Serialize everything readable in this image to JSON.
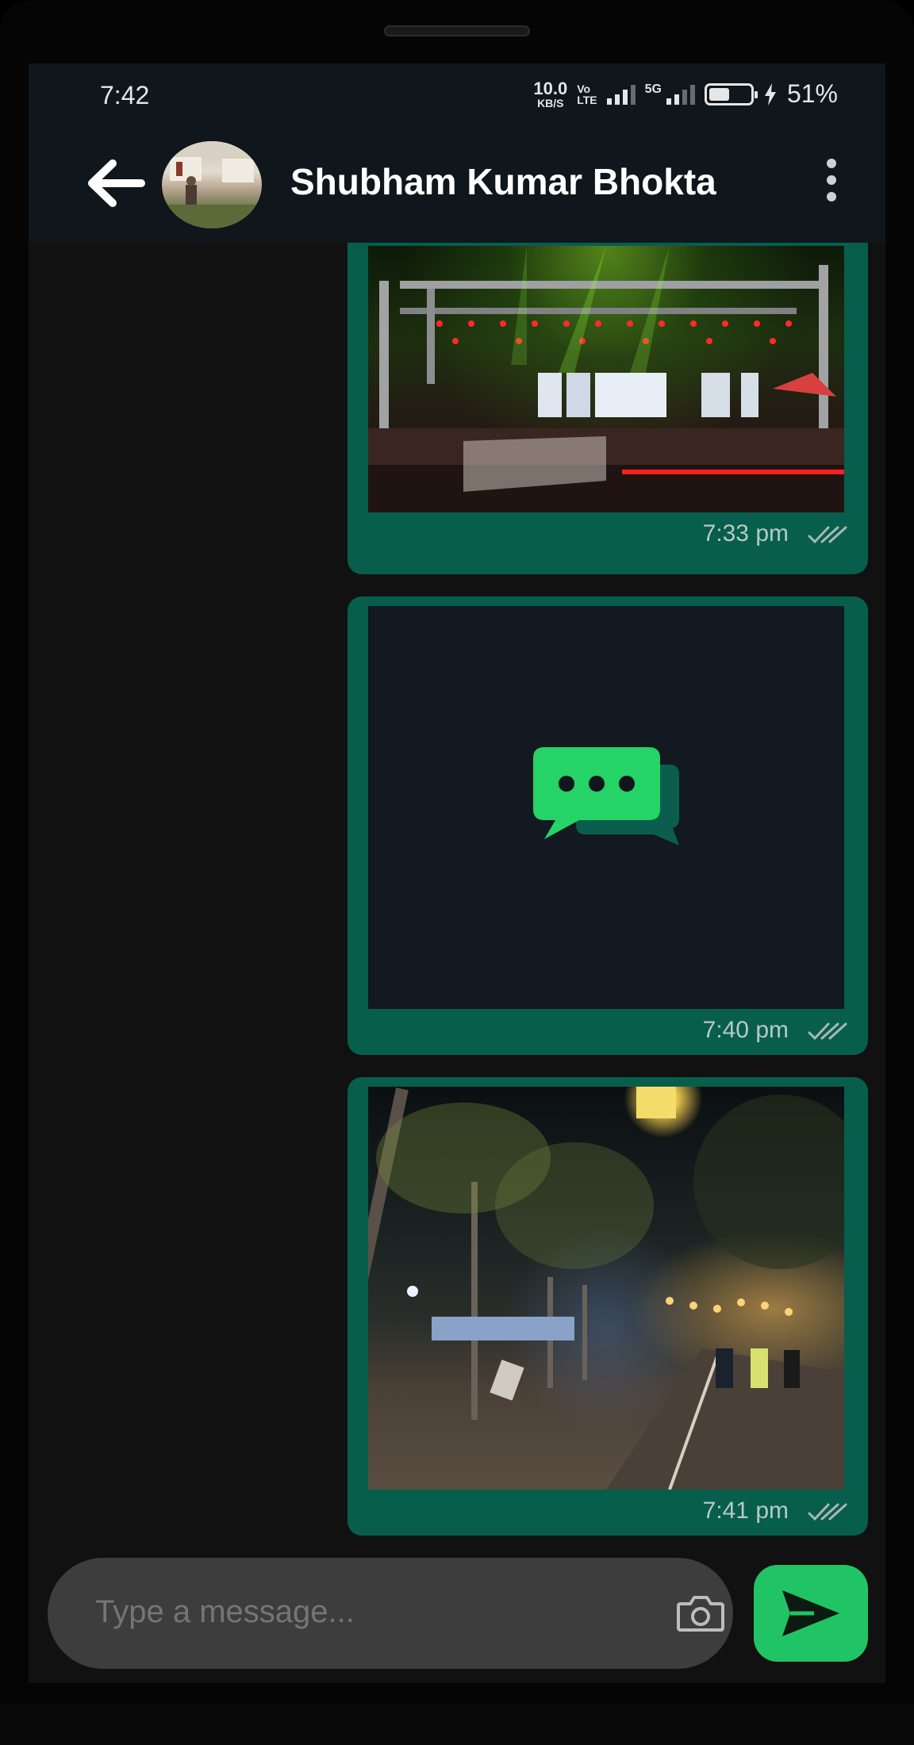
{
  "status_bar": {
    "time": "7:42",
    "net_speed_value": "10.0",
    "net_speed_unit": "KB/S",
    "volte_top": "Vo",
    "volte_bottom": "LTE",
    "network_type": "5G",
    "battery_level": 51,
    "battery_percent": "51%"
  },
  "header": {
    "contact_name": "Shubham Kumar Bhokta"
  },
  "messages": [
    {
      "type": "image",
      "content": "stage-photo",
      "time": "7:33 pm"
    },
    {
      "type": "image",
      "content": "chat-placeholder",
      "time": "7:40 pm"
    },
    {
      "type": "image",
      "content": "park-photo",
      "time": "7:41 pm"
    }
  ],
  "composer": {
    "placeholder": "Type a message..."
  },
  "colors": {
    "bubble": "#075e4c",
    "accent": "#21c464",
    "background": "#111111",
    "header": "#0f161c"
  }
}
